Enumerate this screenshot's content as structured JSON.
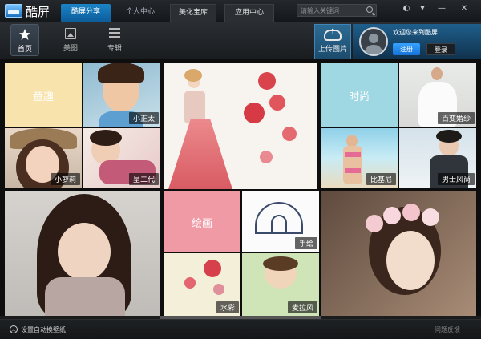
{
  "app": {
    "name": "酷屏"
  },
  "tabs": [
    {
      "label": "酷屏分享"
    },
    {
      "label": "个人中心"
    },
    {
      "label": "美化宝库"
    },
    {
      "label": "应用中心"
    }
  ],
  "search": {
    "placeholder": "请输入关键词"
  },
  "window_controls": {
    "skin": "◐",
    "menu": "▾",
    "minimize": "—",
    "close": "✕"
  },
  "nav": [
    {
      "label": "首页",
      "icon": "star-icon"
    },
    {
      "label": "美图",
      "icon": "image-icon"
    },
    {
      "label": "专辑",
      "icon": "grid-icon"
    }
  ],
  "upload": {
    "label": "上传图片",
    "icon": "cloud-upload-icon"
  },
  "user": {
    "welcome": "欢迎您来到酷屏",
    "register": "注册",
    "login": "登录"
  },
  "tiles": [
    {
      "label": "童趣",
      "kind": "category",
      "color": "#f8e3ad"
    },
    {
      "label": "小正太"
    },
    {
      "label": "小萝莉"
    },
    {
      "label": "星二代"
    },
    {
      "label": "时尚",
      "kind": "category",
      "color": "#9fd7e3"
    },
    {
      "label": "百变婚纱"
    },
    {
      "label": "比基尼"
    },
    {
      "label": "男士风尚"
    },
    {
      "label": "绘画",
      "kind": "category",
      "color": "#ef9aa5"
    },
    {
      "label": "手绘"
    },
    {
      "label": "水彩"
    },
    {
      "label": "麦拉风"
    }
  ],
  "statusbar": {
    "autoswitch": "设置自动换壁纸",
    "feedback": "问题反馈"
  }
}
